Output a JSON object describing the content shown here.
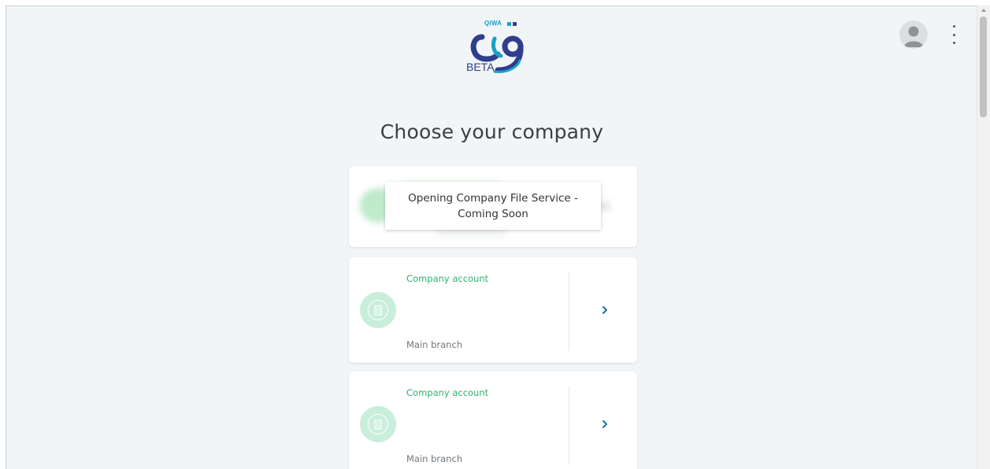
{
  "header": {
    "logo": {
      "top_text": "QIWA",
      "badge": "BETA",
      "brand_color": "#2f3d8c",
      "accent_color": "#1aa0c8"
    },
    "avatar_icon": "user-avatar-icon",
    "menu_icon": "kebab-menu-icon"
  },
  "page": {
    "title": "Choose your company"
  },
  "loading_card": {
    "tooltip": "Opening Company File Service - Coming Soon"
  },
  "companies": [
    {
      "type_label": "Company account",
      "branch": "Main branch",
      "icon": "building-icon",
      "action_icon": "chevron-right-icon"
    },
    {
      "type_label": "Company account",
      "branch": "Main branch",
      "icon": "building-icon",
      "action_icon": "chevron-right-icon"
    }
  ],
  "colors": {
    "background": "#f1f5f8",
    "accent_green": "#2db36a",
    "chevron_blue": "#1d6fa5"
  }
}
